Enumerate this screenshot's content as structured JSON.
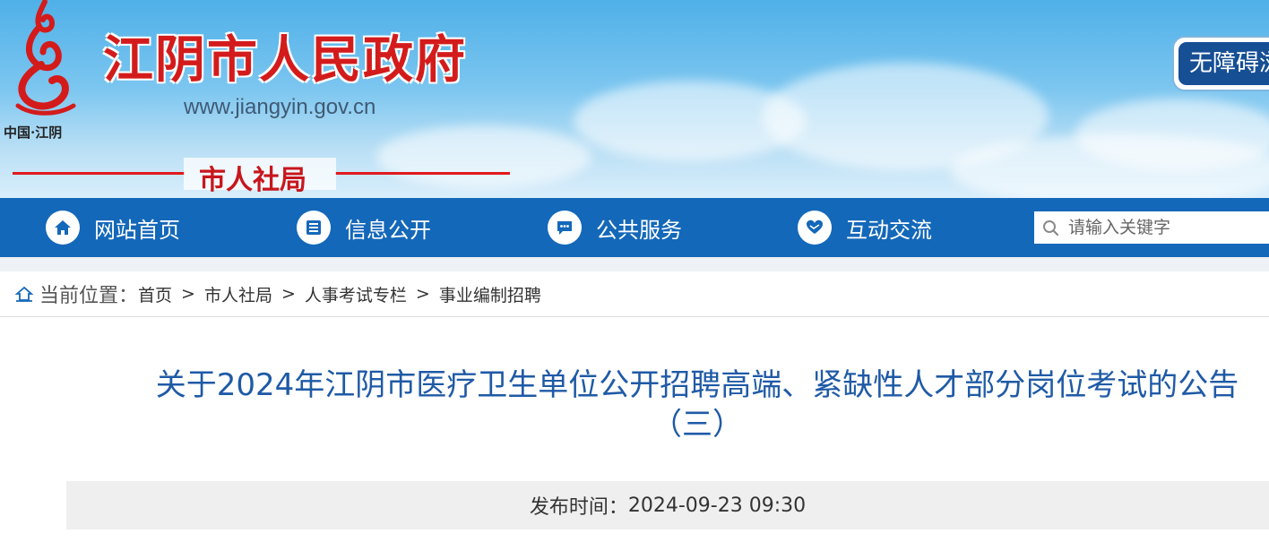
{
  "header": {
    "site_title": "江阴市人民政府",
    "site_url": "www.jiangyin.gov.cn",
    "logo_caption": "中国·江阴",
    "department": "市人社局",
    "accessibility_label": "无障碍浏览"
  },
  "nav": {
    "items": [
      {
        "label": "网站首页",
        "icon": "home-icon"
      },
      {
        "label": "信息公开",
        "icon": "document-icon"
      },
      {
        "label": "公共服务",
        "icon": "chat-icon"
      },
      {
        "label": "互动交流",
        "icon": "handshake-icon"
      }
    ],
    "search": {
      "placeholder": "请输入关键字",
      "value": ""
    }
  },
  "breadcrumb": {
    "prefix": "当前位置：",
    "items": [
      "首页",
      "市人社局",
      "人事考试专栏",
      "事业编制招聘"
    ],
    "separator": ">"
  },
  "article": {
    "title_line1": "关于2024年江阴市医疗卫生单位公开招聘高端、紧缺性人才部分岗位考试的公告",
    "title_line2": "（三）",
    "publish_label": "发布时间：",
    "publish_time": "2024-09-23 09:30"
  },
  "colors": {
    "nav_bg": "#1468b9",
    "title_red": "#d41b1b",
    "article_title_blue": "#1f5aa6"
  }
}
